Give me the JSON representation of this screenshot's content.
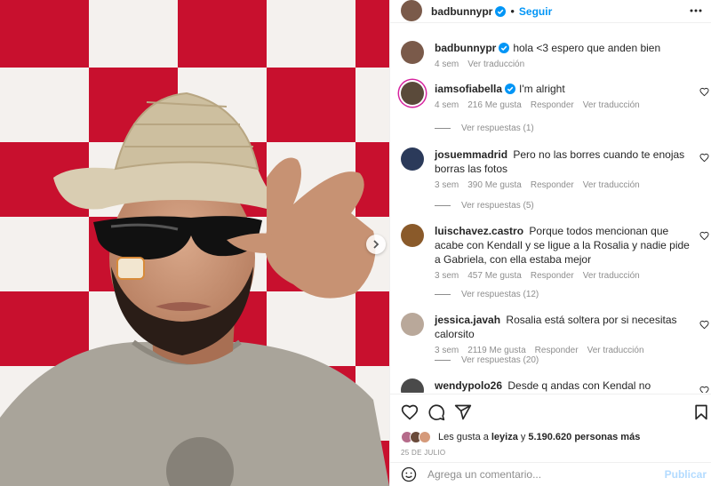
{
  "post": {
    "author": "badbunnypr",
    "follow_label": "Seguir",
    "dot": "•",
    "caption_text": "hola <3 espero que anden bien",
    "caption_time": "4 sem",
    "caption_translate": "Ver traducción",
    "flag_colors": {
      "red": "#c8102e",
      "white": "#f4f1ee"
    }
  },
  "comments": [
    {
      "user": "iamsofiabella",
      "verified": true,
      "text": "I'm alright",
      "time": "4 sem",
      "likes": "216 Me gusta",
      "reply": "Responder",
      "translate": "Ver traducción",
      "replies": "Ver respuestas (1)",
      "avatar_color": "#5a4a3a",
      "ring": true
    },
    {
      "user": "josuemmadrid",
      "verified": false,
      "text": "Pero no las borres cuando te enojas borras las fotos",
      "time": "3 sem",
      "likes": "390 Me gusta",
      "reply": "Responder",
      "translate": "Ver traducción",
      "replies": "Ver respuestas (5)",
      "avatar_color": "#2b3a5a",
      "ring": false
    },
    {
      "user": "luischavez.castro",
      "verified": false,
      "text": "Porque todos mencionan que acabe con Kendall y se ligue a la Rosalia y nadie pide a Gabriela, con ella estaba mejor",
      "time": "3 sem",
      "likes": "457 Me gusta",
      "reply": "Responder",
      "translate": "Ver traducción",
      "replies": "Ver respuestas (12)",
      "avatar_color": "#8a5a2a",
      "ring": false
    },
    {
      "user": "jessica.javah",
      "verified": false,
      "text": "Rosalia está soltera por si necesitas calorsito",
      "time": "3 sem",
      "likes": "2119 Me gusta",
      "reply": "Responder",
      "translate": "Ver traducción",
      "replies": "Ver respuestas (20)",
      "avatar_color": "#b9a89a",
      "ring": false
    },
    {
      "user": "wendypolo26",
      "verified": false,
      "text": "Desde q andas con Kendal no estamos bien",
      "avatar_color": "#4a4a4a",
      "ring": false
    }
  ],
  "likes_bar": {
    "prefix": "Les gusta a",
    "user": "leyiza",
    "connector": "y",
    "others": "5.190.620 personas más"
  },
  "date": "25 DE JULIO",
  "add_comment": {
    "placeholder": "Agrega un comentario...",
    "publish": "Publicar"
  },
  "icons": [
    "heart-icon",
    "comment-icon",
    "share-icon",
    "bookmark-icon",
    "emoji-icon",
    "more-icon",
    "verified-icon",
    "chevron-right-icon"
  ],
  "colors": {
    "accent": "#0095f6",
    "muted": "#8e8e8e",
    "text": "#262626",
    "publish_disabled": "#b3dbff"
  }
}
